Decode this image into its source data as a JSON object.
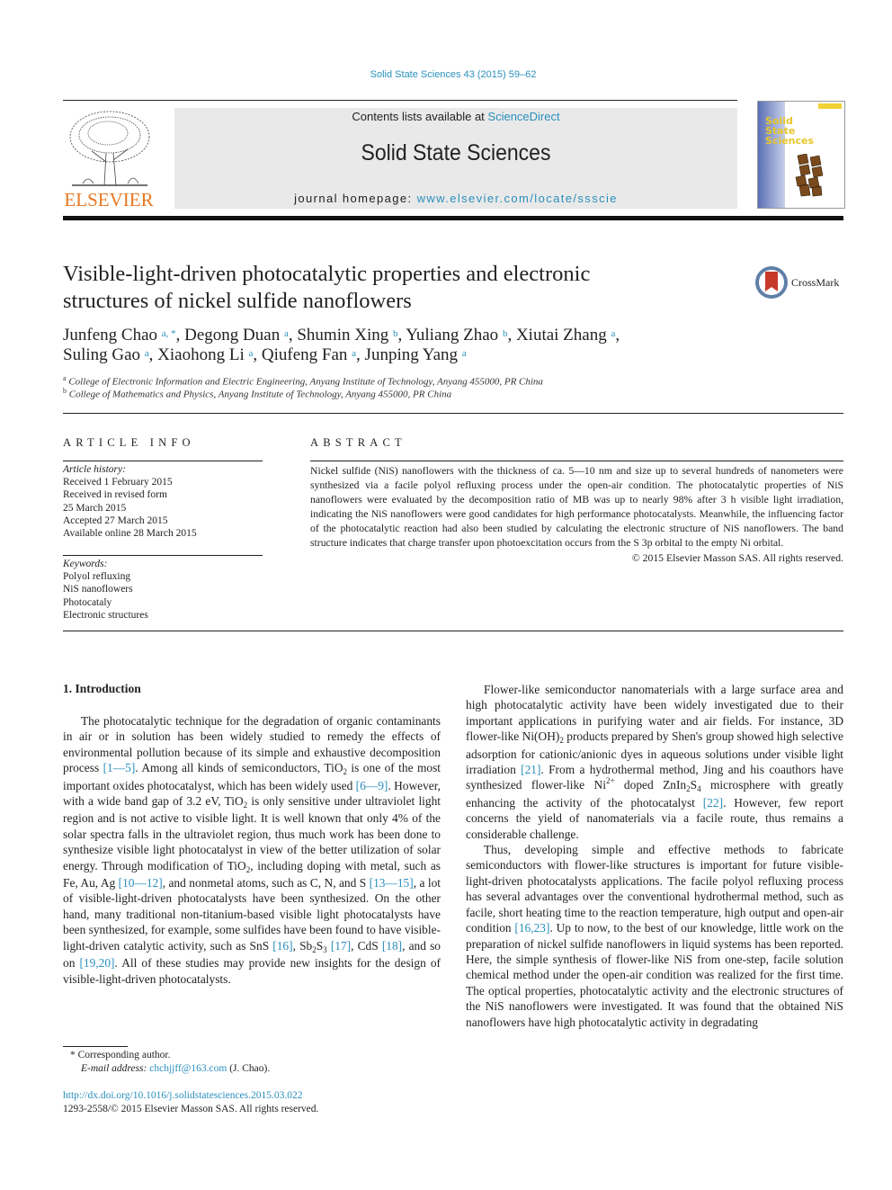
{
  "header": {
    "journal_ref": "Solid State Sciences 43 (2015) 59–62",
    "contents_prefix": "Contents lists available at ",
    "contents_link": "ScienceDirect",
    "journal_title": "Solid State Sciences",
    "homepage_prefix": "journal homepage: ",
    "homepage_link": "www.elsevier.com/locate/ssscie",
    "publisher_logo_text": "ELSEVIER",
    "cover_title_lines": [
      "Solid",
      "State",
      "Sciences"
    ],
    "colors": {
      "link": "#2a8fbd",
      "elsevier_orange": "#e87722",
      "masthead_bg": "#e9e9e9"
    }
  },
  "article": {
    "title_line1": "Visible-light-driven photocatalytic properties and electronic",
    "title_line2": "structures of nickel sulfide nanoflowers",
    "crossmark_label": "CrossMark",
    "authors": [
      {
        "name": "Junfeng Chao",
        "aff": "a, *"
      },
      {
        "name": "Degong Duan",
        "aff": "a"
      },
      {
        "name": "Shumin Xing",
        "aff": "b"
      },
      {
        "name": "Yuliang Zhao",
        "aff": "b"
      },
      {
        "name": "Xiutai Zhang",
        "aff": "a"
      },
      {
        "name": "Suling Gao",
        "aff": "a"
      },
      {
        "name": "Xiaohong Li",
        "aff": "a"
      },
      {
        "name": "Qiufeng Fan",
        "aff": "a"
      },
      {
        "name": "Junping Yang",
        "aff": "a"
      }
    ],
    "affiliations": [
      {
        "key": "a",
        "text": "College of Electronic Information and Electric Engineering, Anyang Institute of Technology, Anyang 455000, PR China"
      },
      {
        "key": "b",
        "text": "College of Mathematics and Physics, Anyang Institute of Technology, Anyang 455000, PR China"
      }
    ]
  },
  "article_info": {
    "heading": "ARTICLE INFO",
    "history_label": "Article history:",
    "history": [
      "Received 1 February 2015",
      "Received in revised form",
      "25 March 2015",
      "Accepted 27 March 2015",
      "Available online 28 March 2015"
    ],
    "keywords_label": "Keywords:",
    "keywords": [
      "Polyol refluxing",
      "NiS nanoflowers",
      "Photocataly",
      "Electronic structures"
    ]
  },
  "abstract": {
    "heading": "ABSTRACT",
    "text": "Nickel sulfide (NiS) nanoflowers with the thickness of ca. 5—10 nm and size up to several hundreds of nanometers were synthesized via a facile polyol refluxing process under the open-air condition. The photocatalytic properties of NiS nanoflowers were evaluated by the decomposition ratio of MB was up to nearly 98% after 3 h visible light irradiation, indicating the NiS nanoflowers were good candidates for high performance photocatalysts. Meanwhile, the influencing factor of the photocatalytic reaction had also been studied by calculating the electronic structure of NiS nanoflowers. The band structure indicates that charge transfer upon photoexcitation occurs from the S 3p orbital to the empty Ni orbital.",
    "copyright": "© 2015 Elsevier Masson SAS. All rights reserved."
  },
  "body": {
    "section_heading": "1.  Introduction",
    "col1": [
      {
        "t": "The photocatalytic technique for the degradation of organic contaminants in air or in solution has been widely studied to remedy the effects of environmental pollution because of its simple and exhaustive decomposition process "
      },
      {
        "ref": "[1—5]"
      },
      {
        "t": ". Among all kinds of semiconductors, TiO"
      },
      {
        "sub": "2"
      },
      {
        "t": " is one of the most important oxides photocatalyst, which has been widely used "
      },
      {
        "ref": "[6—9]"
      },
      {
        "t": ". However, with a wide band gap of 3.2 eV, TiO"
      },
      {
        "sub": "2"
      },
      {
        "t": " is only sensitive under ultraviolet light region and is not active to visible light. It is well known that only 4% of the solar spectra falls in the ultraviolet region, thus much work has been done to synthesize visible light photocatalyst in view of the better utilization of solar energy. Through modification of TiO"
      },
      {
        "sub": "2"
      },
      {
        "t": ", including doping with metal, such as Fe, Au, Ag "
      },
      {
        "ref": "[10—12]"
      },
      {
        "t": ", and nonmetal atoms, such as C, N, and S "
      },
      {
        "ref": "[13—15]"
      },
      {
        "t": ", a lot of visible-light-driven photocatalysts have been synthesized. On the other hand, many traditional non-titanium-based visible light photocatalysts have been synthesized, for example, some sulfides have been found to have visible-light-driven catalytic activity, such as SnS "
      },
      {
        "ref": "[16]"
      },
      {
        "t": ", Sb"
      },
      {
        "sub": "2"
      },
      {
        "t": "S"
      },
      {
        "sub": "3"
      },
      {
        "t": " "
      },
      {
        "ref": "[17]"
      },
      {
        "t": ", CdS "
      },
      {
        "ref": "[18]"
      },
      {
        "t": ", and so on "
      },
      {
        "ref": "[19,20]"
      },
      {
        "t": ". All of these studies may provide new insights for the design of visible-light-driven photocatalysts."
      }
    ],
    "col2_p1": [
      {
        "t": "Flower-like semiconductor nanomaterials with a large surface area and high photocatalytic activity have been widely investigated due to their important applications in purifying water and air fields. For instance, 3D flower-like Ni(OH)"
      },
      {
        "sub": "2"
      },
      {
        "t": " products prepared by Shen's group showed high selective adsorption for cationic/anionic dyes in aqueous solutions under visible light irradiation "
      },
      {
        "ref": "[21]"
      },
      {
        "t": ". From a hydrothermal method, Jing and his coauthors have synthesized flower-like Ni"
      },
      {
        "sup": "2+"
      },
      {
        "t": " doped ZnIn"
      },
      {
        "sub": "2"
      },
      {
        "t": "S"
      },
      {
        "sub": "4"
      },
      {
        "t": " microsphere with greatly enhancing the activity of the photocatalyst "
      },
      {
        "ref": "[22]"
      },
      {
        "t": ". However, few report concerns the yield of nanomaterials via a facile route, thus remains a considerable challenge."
      }
    ],
    "col2_p2": [
      {
        "t": "Thus, developing simple and effective methods to fabricate semiconductors with flower-like structures is important for future visible-light-driven photocatalysts applications. The facile polyol refluxing process has several advantages over the conventional hydrothermal method, such as facile, short heating time to the reaction temperature, high output and open-air condition "
      },
      {
        "ref": "[16,23]"
      },
      {
        "t": ". Up to now, to the best of our knowledge, little work on the preparation of nickel sulfide nanoflowers in liquid systems has been reported. Here, the simple synthesis of flower-like NiS from one-step, facile solution chemical method under the open-air condition was realized for the first time. The optical properties, photocatalytic activity and the electronic structures of the NiS nanoflowers were investigated. It was found that the obtained NiS nanoflowers have high photocatalytic activity in degradating"
      }
    ]
  },
  "footer": {
    "corresponding": "* Corresponding author.",
    "email_label": "E-mail address: ",
    "email": "chchjjff@163.com",
    "email_suffix": " (J. Chao).",
    "doi": "http://dx.doi.org/10.1016/j.solidstatesciences.2015.03.022",
    "issn_copyright": "1293-2558/© 2015 Elsevier Masson SAS. All rights reserved."
  }
}
